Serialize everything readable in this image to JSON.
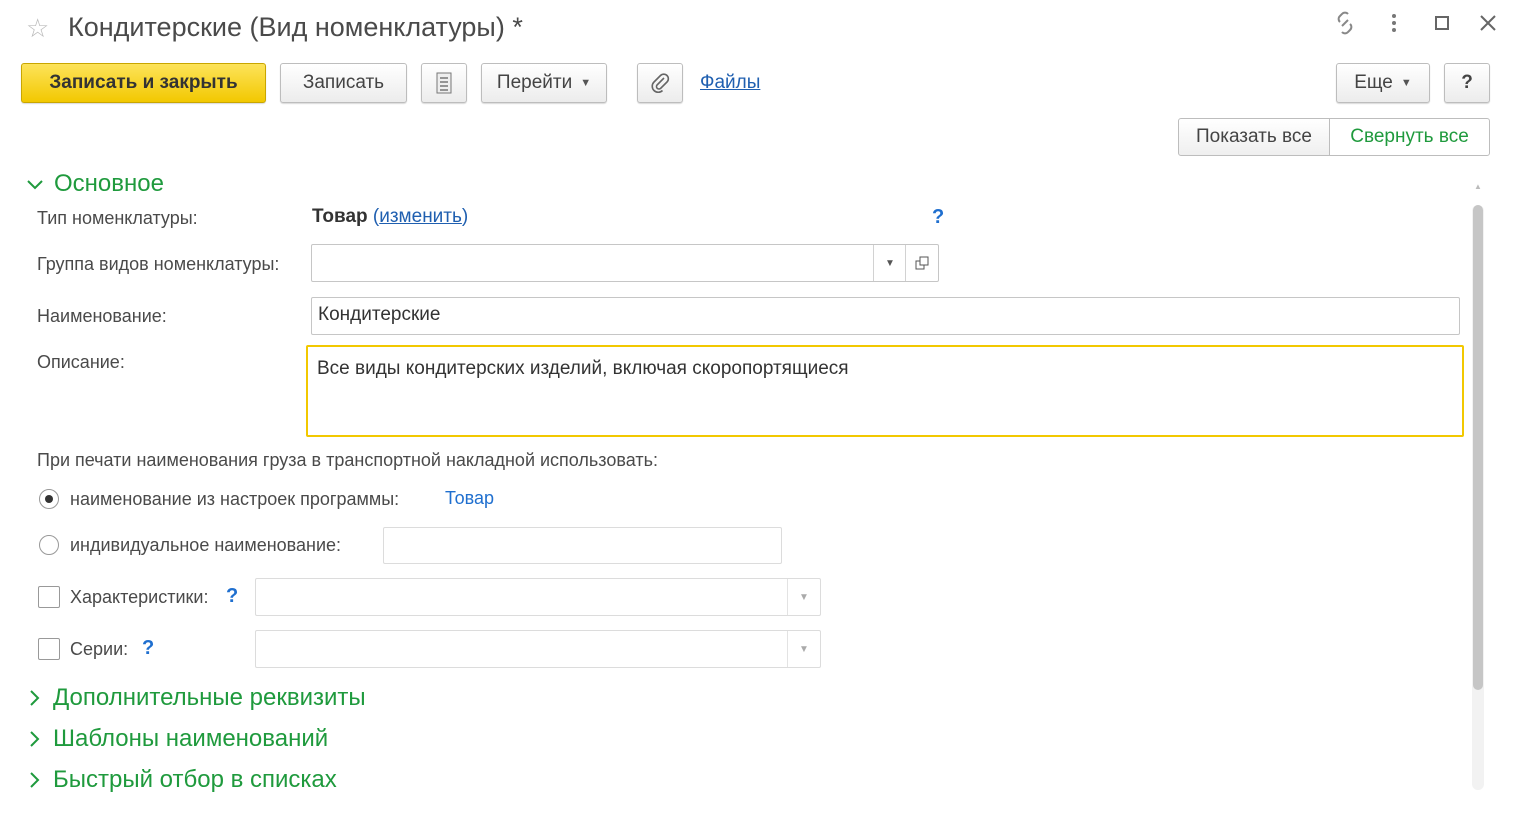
{
  "window": {
    "title": "Кондитерские (Вид номенклатуры) *",
    "star_icon": "star-icon",
    "link_icon": "link-icon",
    "more_icon": "more-vertical-icon",
    "maximize_icon": "maximize-icon",
    "close_icon": "close-icon"
  },
  "toolbar": {
    "save_close_label": "Записать и закрыть",
    "save_label": "Записать",
    "goto_label": "Перейти",
    "files_label": "Файлы",
    "more_label": "Еще",
    "help_label": "?",
    "show_all_label": "Показать все",
    "collapse_all_label": "Свернуть все"
  },
  "main_section": {
    "title": "Основное",
    "type_label": "Тип номенклатуры:",
    "type_value": "Товар",
    "type_change_open": "(",
    "type_change_link": "изменить",
    "type_change_close": ")",
    "type_help": "?",
    "group_label": "Группа видов номенклатуры:",
    "group_value": "",
    "name_label": "Наименование:",
    "name_value": "Кондитерские",
    "desc_label": "Описание:",
    "desc_value": "Все виды кондитерских изделий, включая скоропортящиеся",
    "print_caption": "При печати наименования груза в транспортной накладной использовать:",
    "radio_settings_label": "наименование из настроек программы:",
    "radio_settings_value": "Товар",
    "radio_individual_label": "индивидуальное наименование:",
    "individual_value": "",
    "characteristics_label": "Характеристики:",
    "characteristics_help": "?",
    "characteristics_value": "",
    "series_label": "Серии:",
    "series_help": "?",
    "series_value": ""
  },
  "collapsed_sections": [
    "Дополнительные реквизиты",
    "Шаблоны наименований",
    "Быстрый отбор в списках"
  ],
  "colors": {
    "accent_green": "#1f9a3d",
    "primary_yellow": "#f2c800",
    "link_blue": "#1f5fb0"
  }
}
